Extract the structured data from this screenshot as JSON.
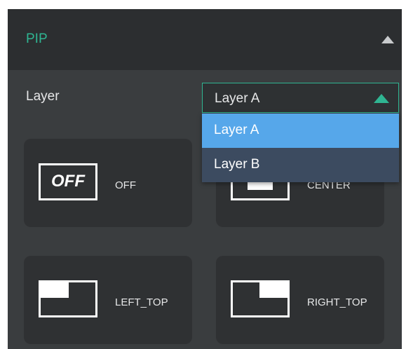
{
  "panel": {
    "title": "PIP",
    "accent_color": "#2fb592",
    "collapse_icon": "triangle-up-icon"
  },
  "layer": {
    "label": "Layer",
    "selected_value": "Layer A",
    "options": [
      "Layer A",
      "Layer B"
    ],
    "highlight_color": "#56a7ea"
  },
  "tiles": [
    {
      "label": "OFF",
      "icon_text": "OFF",
      "icon": "pip-off-icon"
    },
    {
      "label": "CENTER",
      "icon": "pip-center-icon"
    },
    {
      "label": "LEFT_TOP",
      "icon": "pip-left-top-icon"
    },
    {
      "label": "RIGHT_TOP",
      "icon": "pip-right-top-icon"
    }
  ]
}
